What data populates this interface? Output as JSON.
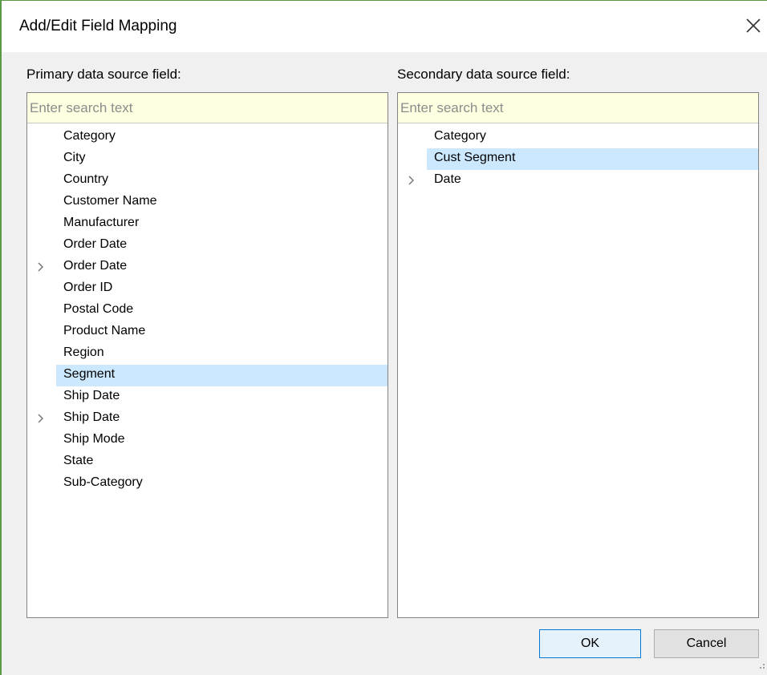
{
  "dialog": {
    "title": "Add/Edit Field Mapping"
  },
  "primary": {
    "label": "Primary data source field:",
    "search_placeholder": "Enter search text",
    "items": [
      {
        "label": "Category",
        "expandable": false,
        "selected": false
      },
      {
        "label": "City",
        "expandable": false,
        "selected": false
      },
      {
        "label": "Country",
        "expandable": false,
        "selected": false
      },
      {
        "label": "Customer Name",
        "expandable": false,
        "selected": false
      },
      {
        "label": "Manufacturer",
        "expandable": false,
        "selected": false
      },
      {
        "label": "Order Date",
        "expandable": false,
        "selected": false
      },
      {
        "label": "Order Date",
        "expandable": true,
        "selected": false
      },
      {
        "label": "Order ID",
        "expandable": false,
        "selected": false
      },
      {
        "label": "Postal Code",
        "expandable": false,
        "selected": false
      },
      {
        "label": "Product Name",
        "expandable": false,
        "selected": false
      },
      {
        "label": "Region",
        "expandable": false,
        "selected": false
      },
      {
        "label": "Segment",
        "expandable": false,
        "selected": true
      },
      {
        "label": "Ship Date",
        "expandable": false,
        "selected": false
      },
      {
        "label": "Ship Date",
        "expandable": true,
        "selected": false
      },
      {
        "label": "Ship Mode",
        "expandable": false,
        "selected": false
      },
      {
        "label": "State",
        "expandable": false,
        "selected": false
      },
      {
        "label": "Sub-Category",
        "expandable": false,
        "selected": false
      }
    ]
  },
  "secondary": {
    "label": "Secondary data source field:",
    "search_placeholder": "Enter search text",
    "items": [
      {
        "label": "Category",
        "expandable": false,
        "selected": false
      },
      {
        "label": "Cust Segment",
        "expandable": false,
        "selected": true
      },
      {
        "label": "Date",
        "expandable": true,
        "selected": false
      }
    ]
  },
  "buttons": {
    "ok_label": "OK",
    "cancel_label": "Cancel"
  },
  "icons": {
    "close": "close-icon",
    "expand": "chevron-right-icon",
    "resize": "resize-grip-icon"
  },
  "colors": {
    "selection": "#cce8ff",
    "search_background": "#ffffe1",
    "window_border": "#5b9a45",
    "ok_border": "#0078d7"
  }
}
